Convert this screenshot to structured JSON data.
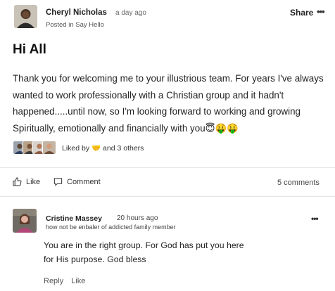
{
  "post": {
    "author_name": "Cheryl Nicholas",
    "timestamp": "a day ago",
    "posted_in": "Posted in Say Hello",
    "share_label": "Share",
    "more_label": "•••",
    "title": "Hi All",
    "body": "Thank you for welcoming me to your illustrious team. For years I've always wanted to work professionally with a Christian group and it hadn't happened.....until now, so I'm looking forward to working and growing Spiritually, emotionally and financially with you😇🤑🤑",
    "liked_by_prefix": "Liked by",
    "liked_by_emoji": "🤝",
    "liked_by_suffix": "and 3 others"
  },
  "actions": {
    "like_label": "Like",
    "comment_label": "Comment",
    "comment_count": "5 comments"
  },
  "comment": {
    "author_name": "Cristine Massey",
    "timestamp": "20 hours ago",
    "tagline": "how not be enbaler of addicted family member",
    "more_label": "•••",
    "text_line1": "You are in the right group. For God has put you here",
    "text_line2": "for His purpose. God bless",
    "reply_label": "Reply",
    "like_label": "Like"
  },
  "colors": {
    "text": "#222222",
    "muted": "#666666",
    "divider": "#e6e6e6",
    "background": "#ffffff"
  },
  "icons": {
    "like": "thumbs-up-icon",
    "comment": "speech-bubble-icon",
    "more": "ellipsis-icon",
    "liked_by_emoji": "handshake-emoji"
  }
}
